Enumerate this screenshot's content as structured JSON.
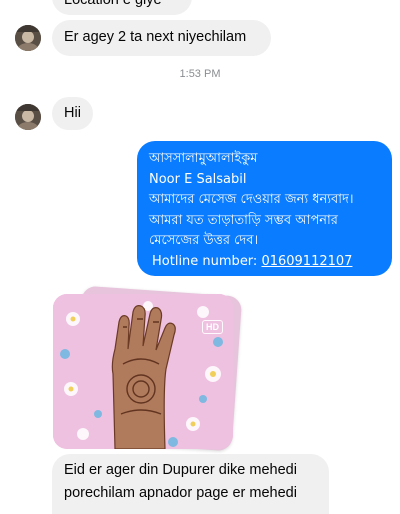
{
  "messages": {
    "partial_top": "Location e giye",
    "msg1": "Er agey 2 ta next niyechilam",
    "timestamp": "1:53 PM",
    "msg2": "Hii",
    "auto_reply": {
      "line1": "আসসালামুআলাইকুম",
      "line2": "Noor E Salsabil",
      "line3": "আমাদের মেসেজ দেওয়ার জন্য ধন্যবাদ।",
      "line4": "আমরা যত তাড়াতাড়ি সম্ভব আপনার",
      "line5": "মেসেজের উত্তর দেব।",
      "hotline_label": "Hotline number:",
      "hotline_number": "01609112107"
    },
    "photo_badge": "HD",
    "msg3_line1": "Eid er ager din Dupurer dike mehedi",
    "msg3_line2": "porechilam apnador page er mehedi"
  },
  "colors": {
    "outgoing_bubble": "#0a7cff",
    "incoming_bubble": "#f0f0f0",
    "timestamp_text": "#8a8d91"
  }
}
